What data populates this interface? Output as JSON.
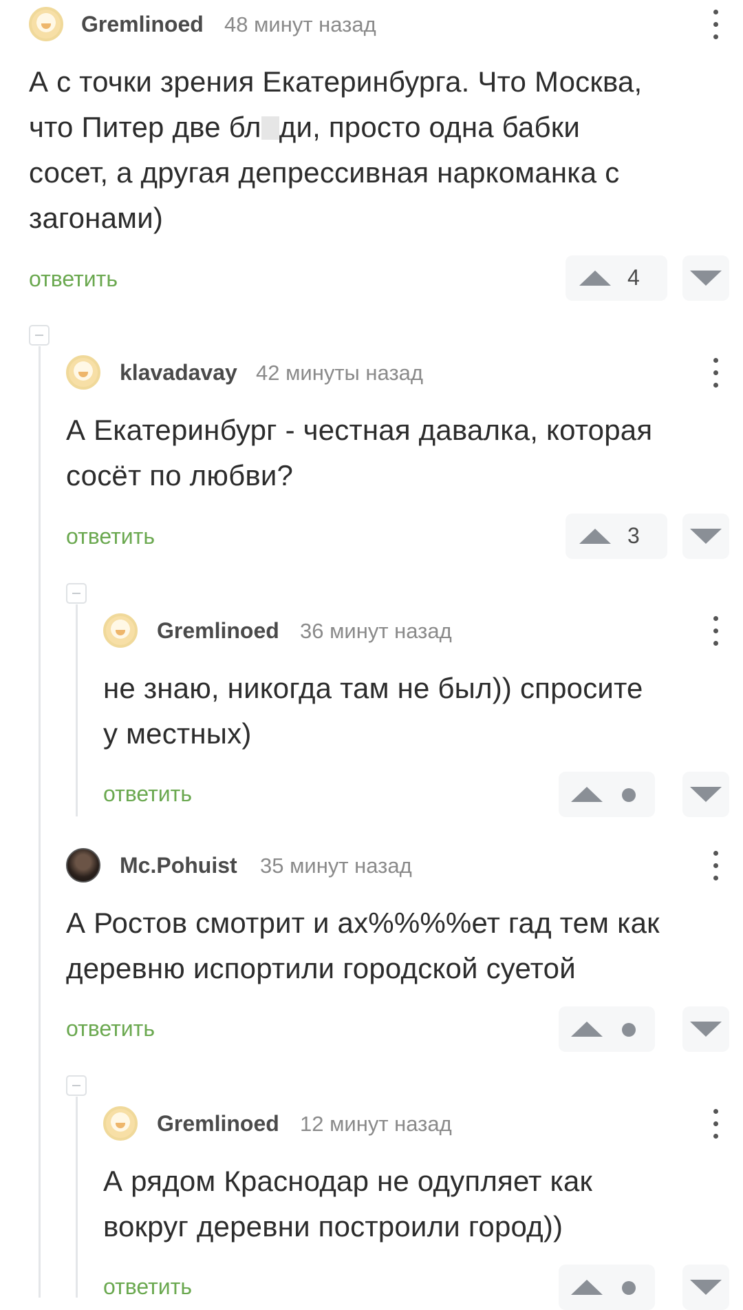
{
  "comments": [
    {
      "username": "Gremlinoed",
      "time": "48 минут назад",
      "lines": [
        "А с точки зрения Екатеринбурга. Что Москва,",
        "что Питер две бл",
        "ди, просто одна бабки",
        "сосет, а другая депрессивная наркоманка с",
        "загонами)"
      ],
      "reply": "ответить",
      "score": "4"
    },
    {
      "username": "klavadavay",
      "time": "42 минуты назад",
      "lines": [
        "А Екатеринбург - честная давалка, которая",
        "сосёт по любви?"
      ],
      "reply": "ответить",
      "score": "3"
    },
    {
      "username": "Gremlinoed",
      "time": "36 минут назад",
      "lines": [
        "не знаю, никогда там не был)) спросите",
        "у местных)"
      ],
      "reply": "ответить",
      "score": ""
    },
    {
      "username": "Mc.Pohuist",
      "time": "35 минут назад",
      "lines": [
        "А Ростов смотрит и ах%%%%ет гад тем как",
        "деревню испортили городской суетой"
      ],
      "reply": "ответить",
      "score": ""
    },
    {
      "username": "Gremlinoed",
      "time": "12 минут назад",
      "lines": [
        "А рядом Краснодар не одупляет как",
        "вокруг деревни построили город))"
      ],
      "reply": "ответить",
      "score": ""
    }
  ],
  "icons": {
    "menu": "more-vertical-icon",
    "upvote": "arrow-up-icon",
    "downvote": "arrow-down-icon",
    "collapse": "collapse-minus-icon",
    "avatar_default": "sheep-avatar-icon"
  },
  "colors": {
    "reply_link": "#6aa84f",
    "vote_bg": "#f6f7f8",
    "vote_icon": "#8a8f96",
    "thread_line": "#e4e6e9"
  }
}
